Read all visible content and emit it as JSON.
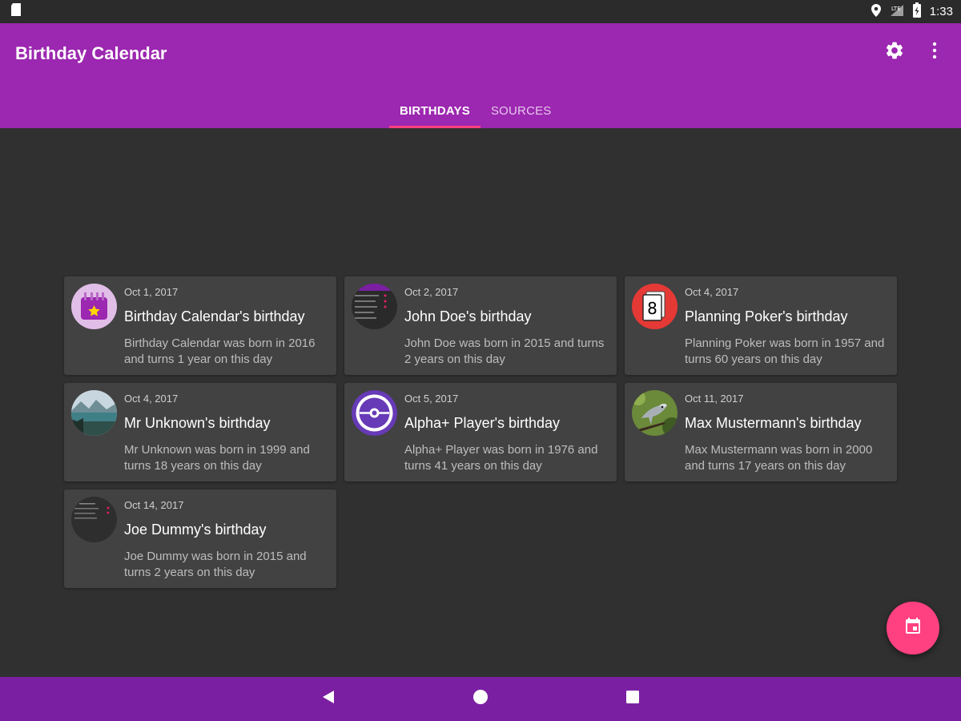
{
  "status_bar": {
    "time": "1:33",
    "network": "LTE"
  },
  "app_bar": {
    "title": "Birthday Calendar"
  },
  "tabs": [
    {
      "label": "BIRTHDAYS",
      "active": true
    },
    {
      "label": "SOURCES",
      "active": false
    }
  ],
  "birthdays": [
    {
      "date": "Oct 1, 2017",
      "title": "Birthday Calendar's birthday",
      "description": "Birthday Calendar was born in 2016 and turns 1 year on this day",
      "avatar": "calendar-app-icon"
    },
    {
      "date": "Oct 2, 2017",
      "title": "John Doe's birthday",
      "description": "John Doe was born in 2015 and turns 2 years on this day",
      "avatar": "app-screenshot-avatar"
    },
    {
      "date": "Oct 4, 2017",
      "title": "Planning Poker's birthday",
      "description": "Planning Poker was born in 1957 and turns 60 years on this day",
      "avatar": "playing-card-icon",
      "avatar_text": "8"
    },
    {
      "date": "Oct 4, 2017",
      "title": "Mr Unknown's birthday",
      "description": "Mr Unknown was born in 1999 and turns 18 years on this day",
      "avatar": "lake-landscape-photo"
    },
    {
      "date": "Oct 5, 2017",
      "title": "Alpha+ Player's birthday",
      "description": "Alpha+ Player was born in 1976 and turns 41 years on this day",
      "avatar": "disc-player-icon"
    },
    {
      "date": "Oct 11, 2017",
      "title": "Max Mustermann's birthday",
      "description": "Max Mustermann was born in 2000 and turns 17 years on this day",
      "avatar": "bird-photo"
    },
    {
      "date": "Oct 14, 2017",
      "title": "Joe Dummy's birthday",
      "description": "Joe Dummy was born in 2015 and turns 2 years on this day",
      "avatar": "app-screenshot-avatar"
    }
  ],
  "colors": {
    "primary": "#9c27b0",
    "primary_dark": "#7b1fa2",
    "accent": "#ff4081",
    "background": "#303030",
    "card": "#424242"
  }
}
